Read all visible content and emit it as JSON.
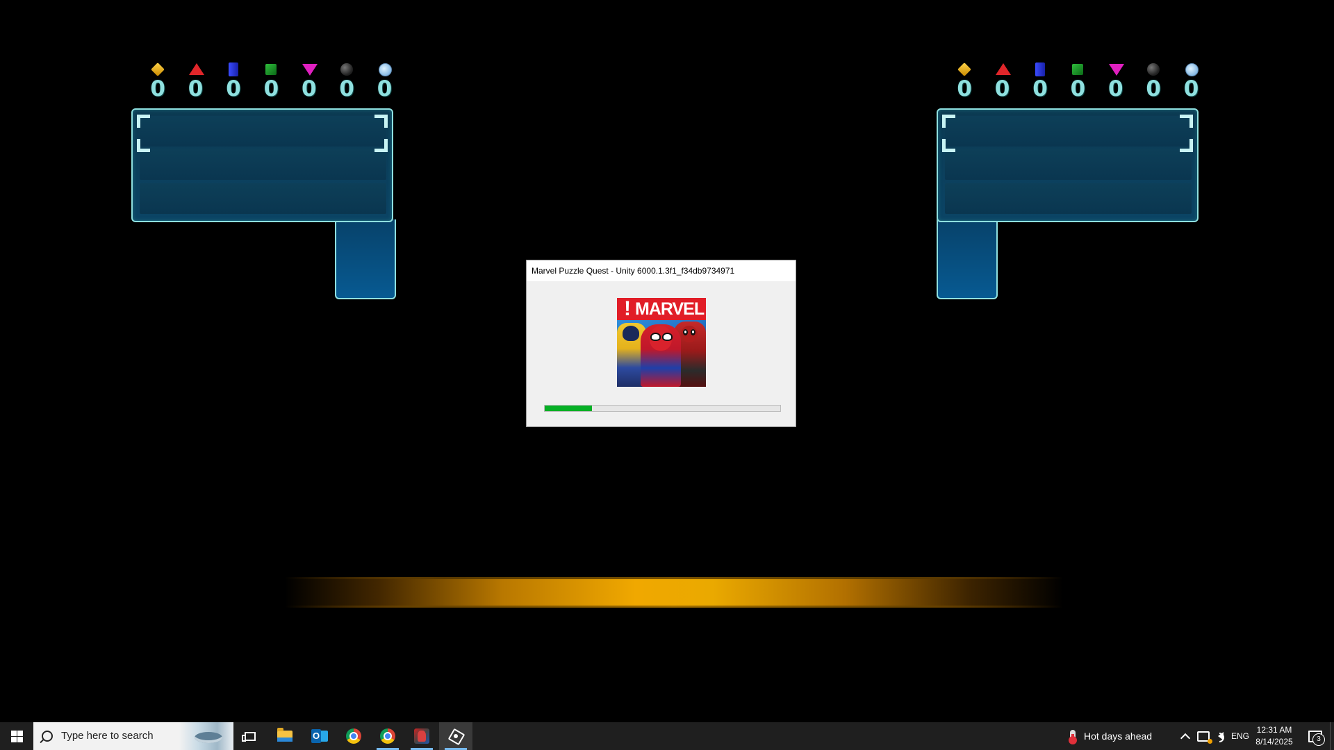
{
  "left_team": {
    "gem_counts": [
      {
        "gem": "yellow-gem",
        "count": "0"
      },
      {
        "gem": "red-gem",
        "count": "0"
      },
      {
        "gem": "blue-gem",
        "count": "0"
      },
      {
        "gem": "green-gem",
        "count": "0"
      },
      {
        "gem": "purple-gem",
        "count": "0"
      },
      {
        "gem": "black-gem",
        "count": "0"
      },
      {
        "gem": "team-up-gem",
        "count": "0"
      }
    ]
  },
  "right_team": {
    "gem_counts": [
      {
        "gem": "yellow-gem",
        "count": "0"
      },
      {
        "gem": "red-gem",
        "count": "0"
      },
      {
        "gem": "blue-gem",
        "count": "0"
      },
      {
        "gem": "green-gem",
        "count": "0"
      },
      {
        "gem": "purple-gem",
        "count": "0"
      },
      {
        "gem": "black-gem",
        "count": "0"
      },
      {
        "gem": "team-up-gem",
        "count": "0"
      }
    ]
  },
  "loading_dialog": {
    "title": "Marvel Puzzle Quest - Unity 6000.1.3f1_f34db9734971",
    "splash_exclaim": "!",
    "splash_brand": "MARVEL",
    "progress": 0.2
  },
  "taskbar": {
    "search_placeholder": "Type here to search",
    "apps": [
      "task-view-icon",
      "file-explorer-icon",
      "outlook-icon",
      "chrome-icon",
      "chrome-icon",
      "marvel-puzzle-quest-icon",
      "unity-icon"
    ],
    "weather": "Hot days ahead",
    "language": "ENG",
    "time": "12:31 AM",
    "date": "8/14/2025",
    "notification_count": "3"
  },
  "colors": {
    "gem_count_text": "#8fe0df",
    "panel_border": "#8fe0e0",
    "progress_fill": "#06b025",
    "glow_bar": "#f0a800",
    "taskbar_bg": "#1f1f1f"
  }
}
